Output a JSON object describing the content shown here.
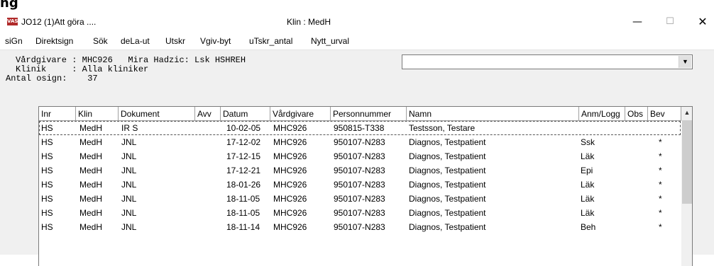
{
  "top_fragment": "ng",
  "window": {
    "icon_label": "VAS",
    "title_left": "JO12 (1)Att göra ....",
    "title_center": "Klin : MedH",
    "min_glyph": "—",
    "max_glyph": "☐",
    "close_glyph": "✕"
  },
  "menu": [
    "siGn",
    "Direktsign",
    "Sök",
    "deLa-ut",
    "Utskr",
    "Vgiv-byt",
    "uTskr_antal",
    "Nytt_urval"
  ],
  "info": {
    "line1": "Vårdgivare : MHC926   Mira Hadzic: Lsk HSHREH",
    "line2": "Klinik     : Alla kliniker",
    "line3": "Antal osign:    37"
  },
  "combo": {
    "value": "",
    "arrow": "▼"
  },
  "table": {
    "columns": [
      "Inr",
      "Klin",
      "Dokument",
      "Avv",
      "Datum",
      "Vårdgivare",
      "Personnummer",
      "Namn",
      "Anm/Logg",
      "Obs",
      "Bev"
    ],
    "rows": [
      [
        "HS",
        "MedH",
        "IR S",
        "",
        "10-02-05",
        "MHC926",
        "950815-T338",
        "Testsson, Testare",
        "",
        "",
        ""
      ],
      [
        "HS",
        "MedH",
        "JNL",
        "",
        "17-12-02",
        "MHC926",
        "950107-N283",
        "Diagnos, Testpatient",
        "Ssk",
        "",
        "*"
      ],
      [
        "HS",
        "MedH",
        "JNL",
        "",
        "17-12-15",
        "MHC926",
        "950107-N283",
        "Diagnos, Testpatient",
        "Läk",
        "",
        "*"
      ],
      [
        "HS",
        "MedH",
        "JNL",
        "",
        "17-12-21",
        "MHC926",
        "950107-N283",
        "Diagnos, Testpatient",
        "Epi",
        "",
        "*"
      ],
      [
        "HS",
        "MedH",
        "JNL",
        "",
        "18-01-26",
        "MHC926",
        "950107-N283",
        "Diagnos, Testpatient",
        "Läk",
        "",
        "*"
      ],
      [
        "HS",
        "MedH",
        "JNL",
        "",
        "18-11-05",
        "MHC926",
        "950107-N283",
        "Diagnos, Testpatient",
        "Läk",
        "",
        "*"
      ],
      [
        "HS",
        "MedH",
        "JNL",
        "",
        "18-11-05",
        "MHC926",
        "950107-N283",
        "Diagnos, Testpatient",
        "Läk",
        "",
        "*"
      ],
      [
        "HS",
        "MedH",
        "JNL",
        "",
        "18-11-14",
        "MHC926",
        "950107-N283",
        "Diagnos, Testpatient",
        "Beh",
        "",
        "*"
      ]
    ]
  },
  "scrollbar": {
    "up_arrow": "▲"
  }
}
